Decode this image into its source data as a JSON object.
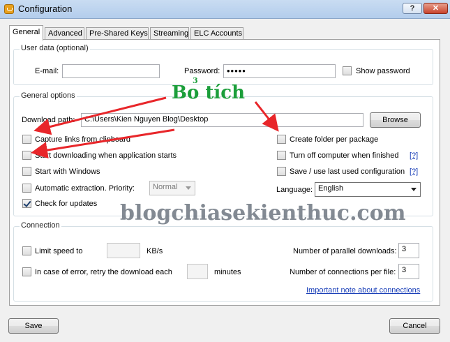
{
  "window": {
    "title": "Configuration",
    "help_label": "?",
    "close_label": "✕"
  },
  "tabs": [
    {
      "label": "General",
      "active": true
    },
    {
      "label": "Advanced",
      "active": false
    },
    {
      "label": "Pre-Shared Keys",
      "active": false
    },
    {
      "label": "Streaming",
      "active": false
    },
    {
      "label": "ELC Accounts",
      "active": false
    }
  ],
  "user_data": {
    "legend": "User data (optional)",
    "email_label": "E-mail:",
    "email_value": "",
    "password_label": "Password:",
    "password_value": "•••••",
    "show_password_label": "Show password",
    "show_password_checked": false
  },
  "general": {
    "legend": "General options",
    "download_path_label": "Download path:",
    "download_path_value": "C:\\Users\\Kien Nguyen Blog\\Desktop",
    "browse_label": "Browse",
    "options_left": [
      {
        "label": "Capture links from clipboard",
        "checked": false
      },
      {
        "label": "Start downloading when application starts",
        "checked": false
      },
      {
        "label": "Start with Windows",
        "checked": false
      },
      {
        "label": "Automatic extraction. Priority:",
        "checked": false
      },
      {
        "label": "Check for updates",
        "checked": true
      }
    ],
    "priority_value": "Normal",
    "options_right": [
      {
        "label": "Create folder per package",
        "checked": false
      },
      {
        "label": "Turn off computer when finished",
        "checked": false,
        "help": "[?]"
      },
      {
        "label": "Save / use last used configuration",
        "checked": false,
        "help": "[?]"
      }
    ],
    "language_label": "Language:",
    "language_value": "English"
  },
  "connection": {
    "legend": "Connection",
    "limit_speed_label": "Limit speed to",
    "limit_speed_checked": false,
    "limit_speed_value": "",
    "limit_speed_unit": "KB/s",
    "retry_label": "In case of error, retry the download each",
    "retry_checked": false,
    "retry_value": "",
    "retry_unit": "minutes",
    "parallel_label": "Number of parallel downloads:",
    "parallel_value": "3",
    "connections_label": "Number of connections per file:",
    "connections_value": "3",
    "note_link": "Important note about connections"
  },
  "footer": {
    "save_label": "Save",
    "cancel_label": "Cancel"
  },
  "annotation": {
    "text": "Bo tích",
    "number": "3"
  },
  "watermark": "blogchiasekienthuc.com",
  "colors": {
    "annotation": "#1b9e3a",
    "arrow": "#e8262a",
    "link": "#1a3fb8"
  }
}
